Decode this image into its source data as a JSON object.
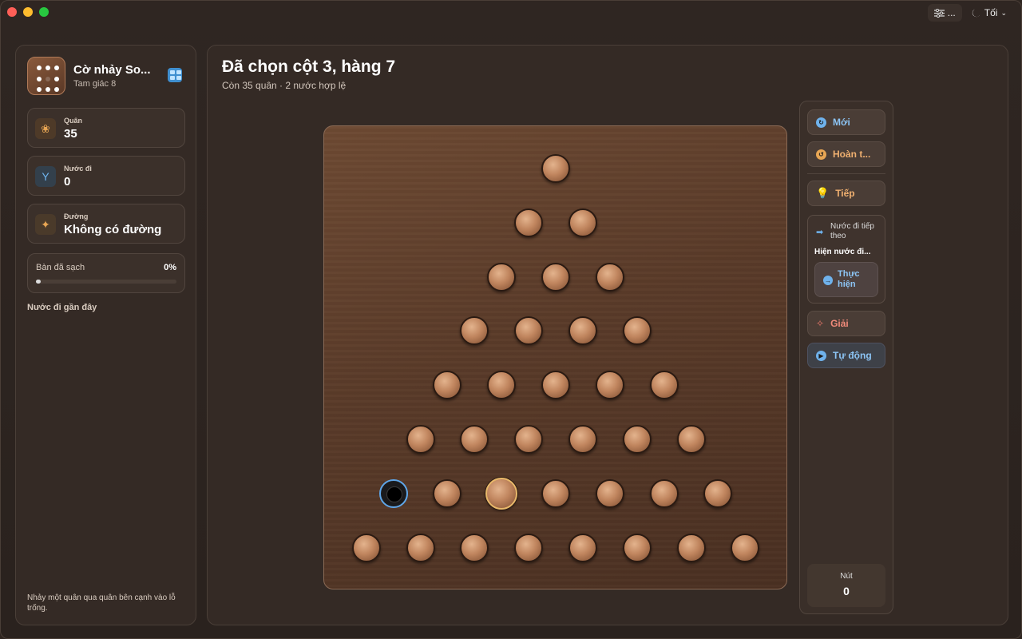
{
  "titlebar": {
    "more_label": "...",
    "theme_label": "Tối"
  },
  "sidebar": {
    "app_title": "Cờ nhảy So...",
    "app_subtitle": "Tam giác 8",
    "stats": [
      {
        "label": "Quân",
        "value": "35",
        "icon": "pegs-icon",
        "color": "#e8a654"
      },
      {
        "label": "Nước đi",
        "value": "0",
        "icon": "branch-icon",
        "color": "#6fb2ec"
      },
      {
        "label": "Đường",
        "value": "Không có đường",
        "icon": "sparkle-icon",
        "color": "#e8a654"
      }
    ],
    "progress": {
      "label": "Bàn đã sạch",
      "percent_text": "0%",
      "value": 0
    },
    "recent_label": "Nước đi gần đây",
    "hint": "Nhảy một quân qua quân bên cạnh vào lỗ trống."
  },
  "main": {
    "title": "Đã chọn cột 3, hàng 7",
    "subtitle": "Còn 35 quân · 2 nước hợp lệ"
  },
  "board": {
    "rows": 8,
    "selected": {
      "row": 7,
      "col": 3
    },
    "empty": [
      {
        "row": 7,
        "col": 1
      }
    ]
  },
  "tools": {
    "new_label": "Mới",
    "undo_label": "Hoàn t...",
    "hint_label": "Tiếp",
    "next_move_title": "Nước đi tiếp theo",
    "next_move_show": "Hiện nước đi...",
    "execute_label": "Thực hiện",
    "solve_label": "Giải",
    "auto_label": "Tự động",
    "node_label": "Nút",
    "node_value": "0",
    "colors": {
      "blue": "#6fb2ec",
      "orange": "#e8a654",
      "red": "#e8776a"
    }
  }
}
